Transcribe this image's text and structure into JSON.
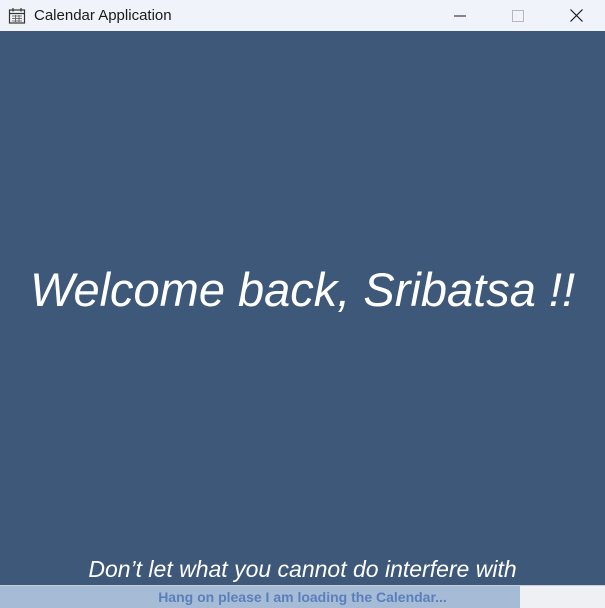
{
  "window": {
    "title": "Calendar Application",
    "icon": "calendar-icon"
  },
  "controls": {
    "minimize_icon": "minimize-icon",
    "maximize_icon": "maximize-icon",
    "close_icon": "close-icon"
  },
  "main": {
    "welcome": "Welcome back, Sribatsa !!",
    "quote": "Don’t let what you cannot do interfere with"
  },
  "progress": {
    "label": "Hang on please I am loading the Calendar...",
    "percent": 86
  },
  "colors": {
    "background": "#3d5878",
    "titlebar": "#f0f3f9",
    "progress_fill": "#a6bbd6",
    "progress_text": "#5a7fbb"
  }
}
